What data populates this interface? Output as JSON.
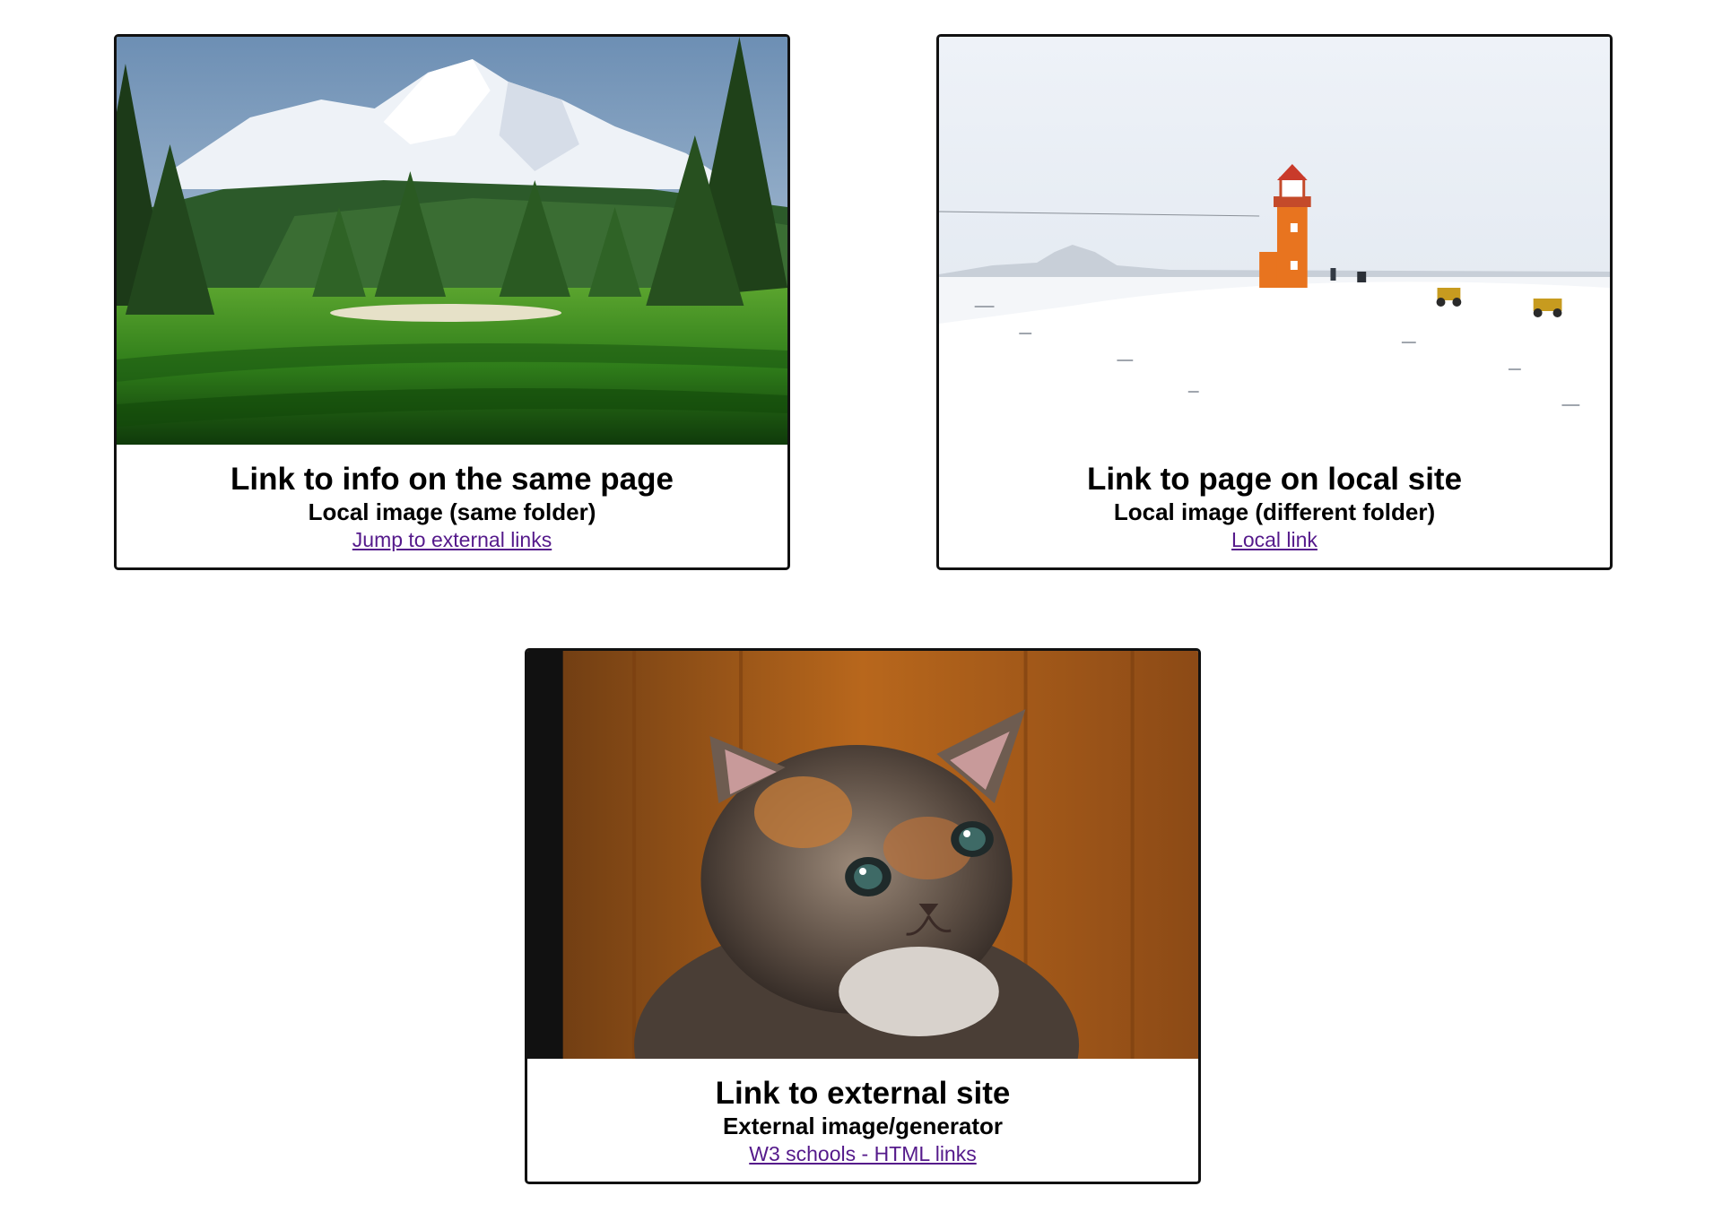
{
  "cards": [
    {
      "title": "Link to info on the same page",
      "subtitle": "Local image (same folder)",
      "link_text": "Jump to external links",
      "image": "mountain-golf-course"
    },
    {
      "title": "Link to page on local site",
      "subtitle": "Local image (different folder)",
      "link_text": "Local link",
      "image": "snowy-lighthouse"
    },
    {
      "title": "Link to external site",
      "subtitle": "External image/generator",
      "link_text": "W3 schools - HTML links",
      "image": "calico-kitten"
    }
  ],
  "colors": {
    "link": "#551a8b",
    "border": "#111111",
    "lighthouse": "#e8741f"
  }
}
